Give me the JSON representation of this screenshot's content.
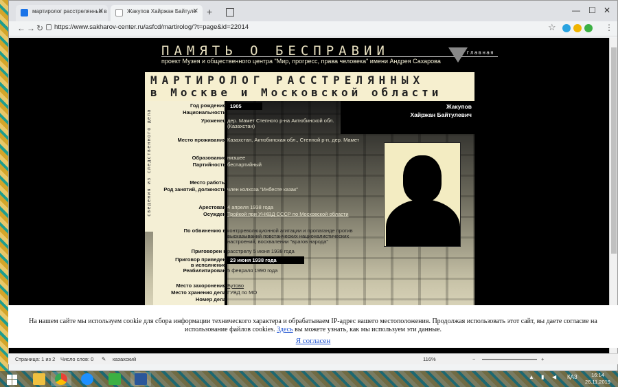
{
  "browser": {
    "tabs": [
      {
        "label": "мартиролог расстрелянных в"
      },
      {
        "label": "Жакупов Хайржан Байтуле"
      }
    ],
    "url": "https://www.sakharov-center.ru/asfcd/martirolog/?t=page&id=22014",
    "new_tab": "+",
    "win_min": "—",
    "win_max": "☐",
    "win_close": "✕"
  },
  "site": {
    "title": "ПАМЯТЬ О БЕСПРАВИИ",
    "subtitle": "проект Музея и общественного центра \"Мир, прогресс, права человека\" имени Андрея Сахарова",
    "main_link": "главная",
    "banner_line1": "МАРТИРОЛОГ РАССТРЕЛЯННЫХ",
    "banner_line2": "в Москве и Московской области",
    "sidebar_label": "сведения из следственного дела"
  },
  "person": {
    "surname": "Жакупов",
    "name": "Хайржан Байтулевич"
  },
  "fields": [
    {
      "label": "Год рождения",
      "value": "1905"
    },
    {
      "label": "Национальность",
      "value": ""
    },
    {
      "label": "Уроженец",
      "value": "дер. Мамет Степного р-на Актюбинской обл."
    },
    {
      "label": "",
      "value": "(Казахстан)"
    },
    {
      "label": "Место проживания",
      "value": "Казахстан, Актюбинская обл., Степной р-н, дер. Мамет"
    },
    {
      "label": "Образование",
      "value": "низшее"
    },
    {
      "label": "Партийность",
      "value": "беспартийный"
    },
    {
      "label": "Место работы",
      "value": ""
    },
    {
      "label": "Род занятий, должность",
      "value": "член колхоза \"Инбесте казак\""
    },
    {
      "label": "Арестован",
      "value": "4 апреля 1938 года"
    },
    {
      "label": "Осужден",
      "value": "Тройкой при УНКВД СССР по Московской области"
    },
    {
      "label": "По обвинению в",
      "value": "контрреволюционной агитации и пропаганде против"
    },
    {
      "label": "",
      "value": "высказываний повстанческих националистических"
    },
    {
      "label": "",
      "value": "настроений, восхвалении \"врагов народа\""
    },
    {
      "label": "Приговорен к",
      "value": "расстрелу 5 июня 1938 года"
    },
    {
      "label": "Приговор приведен",
      "value": "23 июня 1938 года"
    },
    {
      "label": "в исполнение",
      "value": ""
    },
    {
      "label": "Реабилитирован",
      "value": "5 февраля 1990 года"
    },
    {
      "label": "Место захоронения",
      "value": "Бутово"
    },
    {
      "label": "Место хранения дела",
      "value": "ГУВД по МО"
    },
    {
      "label": "Номер дела",
      "value": ""
    }
  ],
  "cookie": {
    "text1": "На нашем сайте мы используем cookie для сбора информации технического характера и обрабатываем IP-адрес вашего местоположения. Продолжая использовать этот сайт, вы даете согласие на",
    "text2a": "использование файлов cookies.",
    "link": "Здесь",
    "text2b": "вы можете узнать, как мы используем эти данные.",
    "agree": "Я согласен"
  },
  "statusbar": {
    "page": "Страница: 1 из 2",
    "words": "Число слов: 0",
    "lang": "казахский",
    "zoom": "116%"
  },
  "taskbar": {
    "lang": "ҚАЗ",
    "time": "16:14",
    "date": "26.11.2019"
  },
  "colors": {
    "accent": "#1a73e8",
    "page_bg": "#000000",
    "banner_bg": "#f6efcf"
  }
}
